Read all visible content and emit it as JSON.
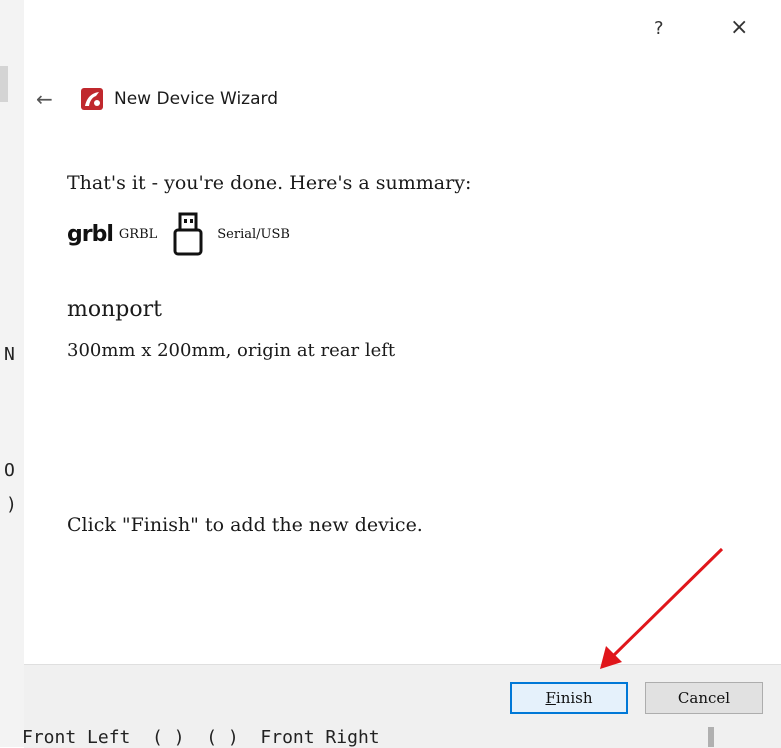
{
  "dialog": {
    "help_label": "?",
    "close_label": "×",
    "back_label": "←",
    "title": "New Device Wizard"
  },
  "summary": {
    "intro": "That's it - you're done.  Here's a summary:",
    "driver_logo": "grbl",
    "driver_name": "GRBL",
    "connection": "Serial/USB",
    "device_name": "monport",
    "device_dims": "300mm x 200mm, origin at rear left",
    "finish_hint": "Click \"Finish\" to add the new device."
  },
  "buttons": {
    "finish_accel": "F",
    "finish_rest": "inish",
    "cancel": "Cancel"
  },
  "background": {
    "frag_w": "N",
    "frag_o": "O",
    "frag_paren": ")",
    "bottom_row": "Front Left  ( )  ( )  Front Right"
  },
  "colors": {
    "annotation_arrow": "#e0161b",
    "logo_red": "#c0282d",
    "accent_blue": "#0078d7"
  }
}
